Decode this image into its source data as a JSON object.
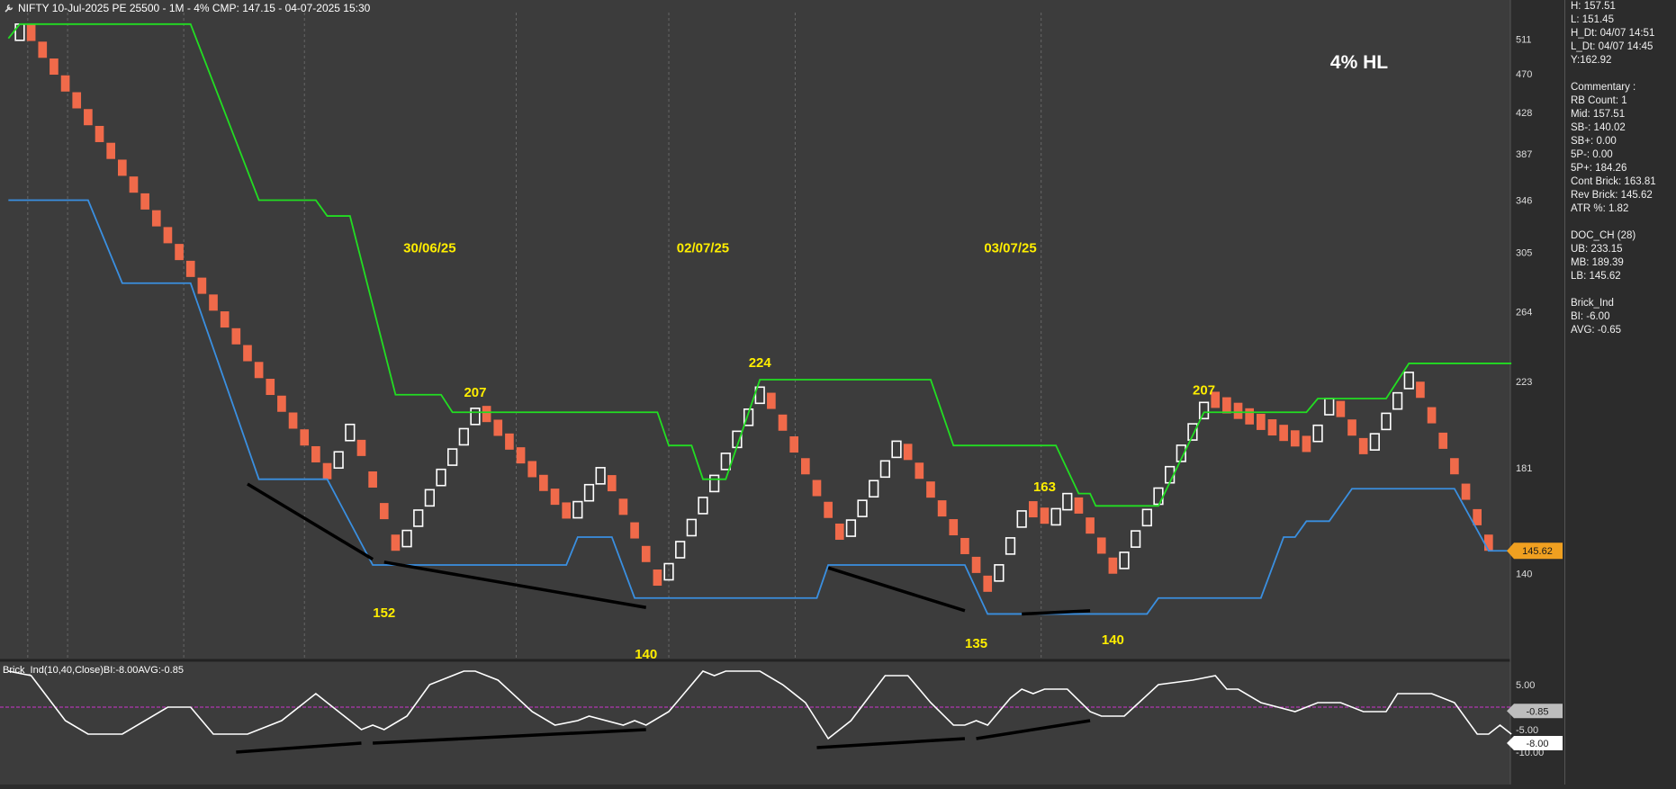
{
  "header": {
    "title": "NIFTY 10-Jul-2025 PE 25500 - 1M - 4% CMP: 147.15 - 04-07-2025 15:30",
    "corner_label": "4% HL"
  },
  "side_panel": {
    "groups": [
      [
        "H: 157.51",
        "L: 151.45",
        "H_Dt: 04/07 14:51",
        "L_Dt: 04/07 14:45",
        "Y:162.92"
      ],
      [
        "Commentary :",
        "RB Count: 1",
        "Mid: 157.51",
        "SB-: 140.02",
        "SB+: 0.00",
        "5P-: 0.00",
        "5P+: 184.26",
        "Cont Brick: 163.81",
        "Rev Brick: 145.62",
        "ATR %: 1.82"
      ],
      [
        "DOC_CH (28)",
        "UB: 233.15",
        "MB: 189.39",
        "LB: 145.62"
      ],
      [
        "Brick_Ind",
        "BI: -6.00",
        "AVG: -0.65"
      ]
    ]
  },
  "colors": {
    "background": "#3c3c3c",
    "up_brick": "#ffffff",
    "down_brick": "#f06a4a",
    "upper_band": "#22dd22",
    "lower_band": "#3a8fe0",
    "annotation": "#ffee00",
    "indicator_line": "#ffffff",
    "zero_line": "#cc33cc",
    "price_tag": "#f0a020"
  },
  "chart_data": [
    {
      "type": "renko",
      "title": "NIFTY 10-Jul-2025 PE 25500 - 1M - 4% CMP: 147.15 - 04-07-2025 15:30",
      "ylim": [
        114,
        545
      ],
      "y_ticks": [
        140,
        181,
        223,
        264,
        305,
        346,
        387,
        428,
        470,
        511
      ],
      "brick_size_pct": 4,
      "n_columns": 133,
      "date_labels": [
        {
          "text": "30/06/25",
          "col": 37,
          "y": 305
        },
        {
          "text": "02/07/25",
          "col": 61,
          "y": 305
        },
        {
          "text": "03/07/25",
          "col": 88,
          "y": 305
        }
      ],
      "price_annotations": [
        {
          "text": "152",
          "col": 33,
          "y": 126
        },
        {
          "text": "207",
          "col": 41,
          "y": 215
        },
        {
          "text": "140",
          "col": 56,
          "y": 114
        },
        {
          "text": "224",
          "col": 66,
          "y": 231
        },
        {
          "text": "135",
          "col": 85,
          "y": 117
        },
        {
          "text": "163",
          "col": 91,
          "y": 171
        },
        {
          "text": "140",
          "col": 97,
          "y": 118
        },
        {
          "text": "207",
          "col": 105,
          "y": 216
        }
      ],
      "current_price_tag": "145.62",
      "pivots": [
        {
          "col": 0,
          "y": 475
        },
        {
          "col": 1,
          "y": 530
        },
        {
          "col": 28,
          "y": 176
        },
        {
          "col": 30,
          "y": 201
        },
        {
          "col": 34,
          "y": 148
        },
        {
          "col": 41,
          "y": 209
        },
        {
          "col": 49,
          "y": 160
        },
        {
          "col": 52,
          "y": 181
        },
        {
          "col": 57,
          "y": 136
        },
        {
          "col": 66,
          "y": 220
        },
        {
          "col": 73,
          "y": 152
        },
        {
          "col": 78,
          "y": 193
        },
        {
          "col": 86,
          "y": 134
        },
        {
          "col": 89,
          "y": 163
        },
        {
          "col": 91,
          "y": 158
        },
        {
          "col": 93,
          "y": 170
        },
        {
          "col": 97,
          "y": 140
        },
        {
          "col": 105,
          "y": 212
        },
        {
          "col": 114,
          "y": 188
        },
        {
          "col": 116,
          "y": 214
        },
        {
          "col": 119,
          "y": 187
        },
        {
          "col": 123,
          "y": 228
        },
        {
          "col": 130,
          "y": 148
        }
      ],
      "series": [
        {
          "name": "UB",
          "points": [
            {
              "col": 0,
              "y": 512
            },
            {
              "col": 1,
              "y": 530
            },
            {
              "col": 16,
              "y": 530
            },
            {
              "col": 22,
              "y": 346
            },
            {
              "col": 27,
              "y": 346
            },
            {
              "col": 28,
              "y": 333
            },
            {
              "col": 30,
              "y": 333
            },
            {
              "col": 34,
              "y": 216
            },
            {
              "col": 38,
              "y": 216
            },
            {
              "col": 39,
              "y": 207
            },
            {
              "col": 57,
              "y": 207
            },
            {
              "col": 58,
              "y": 191
            },
            {
              "col": 60,
              "y": 191
            },
            {
              "col": 61,
              "y": 176
            },
            {
              "col": 63,
              "y": 176
            },
            {
              "col": 66,
              "y": 224
            },
            {
              "col": 81,
              "y": 224
            },
            {
              "col": 83,
              "y": 191
            },
            {
              "col": 92,
              "y": 191
            },
            {
              "col": 94,
              "y": 170
            },
            {
              "col": 95,
              "y": 170
            },
            {
              "col": 95.5,
              "y": 165
            },
            {
              "col": 101,
              "y": 165
            },
            {
              "col": 105,
              "y": 207
            },
            {
              "col": 114,
              "y": 207
            },
            {
              "col": 115,
              "y": 214
            },
            {
              "col": 121,
              "y": 214
            },
            {
              "col": 123,
              "y": 233
            },
            {
              "col": 132,
              "y": 233
            }
          ]
        },
        {
          "name": "LB",
          "points": [
            {
              "col": 0,
              "y": 346
            },
            {
              "col": 7,
              "y": 346
            },
            {
              "col": 10,
              "y": 283
            },
            {
              "col": 16,
              "y": 283
            },
            {
              "col": 22,
              "y": 176
            },
            {
              "col": 28,
              "y": 176
            },
            {
              "col": 32,
              "y": 143
            },
            {
              "col": 49,
              "y": 143
            },
            {
              "col": 50,
              "y": 153
            },
            {
              "col": 53,
              "y": 153
            },
            {
              "col": 55,
              "y": 132
            },
            {
              "col": 71,
              "y": 132
            },
            {
              "col": 72,
              "y": 143
            },
            {
              "col": 84,
              "y": 143
            },
            {
              "col": 86,
              "y": 127
            },
            {
              "col": 100,
              "y": 127
            },
            {
              "col": 101,
              "y": 132
            },
            {
              "col": 110,
              "y": 132
            },
            {
              "col": 112,
              "y": 153
            },
            {
              "col": 113,
              "y": 153
            },
            {
              "col": 114,
              "y": 159
            },
            {
              "col": 116,
              "y": 159
            },
            {
              "col": 118,
              "y": 172
            },
            {
              "col": 127,
              "y": 172
            },
            {
              "col": 130,
              "y": 148
            },
            {
              "col": 132,
              "y": 148
            }
          ]
        }
      ],
      "trendlines": [
        {
          "from": {
            "col": 21,
            "y": 174
          },
          "to": {
            "col": 32,
            "y": 145
          }
        },
        {
          "from": {
            "col": 33,
            "y": 144
          },
          "to": {
            "col": 56,
            "y": 129
          }
        },
        {
          "from": {
            "col": 72,
            "y": 142
          },
          "to": {
            "col": 84,
            "y": 128
          }
        },
        {
          "from": {
            "col": 89,
            "y": 127
          },
          "to": {
            "col": 95,
            "y": 128
          }
        }
      ]
    },
    {
      "type": "line",
      "title": "Brick_Ind(10,40,Close)BI:-8.00AVG:-0.85",
      "ylim": [
        -16,
        10
      ],
      "y_ticks": [
        5,
        0,
        -5,
        -10
      ],
      "y_tick_labels": [
        "5.00",
        "0.00",
        "-5.00",
        "-10.00"
      ],
      "zero_line": 0,
      "current_value_tags": [
        {
          "text": "-0.85",
          "value": -0.85,
          "style": "grey"
        },
        {
          "text": "-8.00",
          "value": -8.0,
          "style": "white"
        }
      ],
      "series": [
        {
          "name": "BI",
          "points": [
            {
              "col": 0,
              "y": 8
            },
            {
              "col": 2,
              "y": 7
            },
            {
              "col": 5,
              "y": -3
            },
            {
              "col": 7,
              "y": -6
            },
            {
              "col": 10,
              "y": -6
            },
            {
              "col": 14,
              "y": 0
            },
            {
              "col": 16,
              "y": 0
            },
            {
              "col": 18,
              "y": -6
            },
            {
              "col": 21,
              "y": -6
            },
            {
              "col": 24,
              "y": -3
            },
            {
              "col": 26,
              "y": 1
            },
            {
              "col": 27,
              "y": 3
            },
            {
              "col": 30,
              "y": -3
            },
            {
              "col": 31,
              "y": -5
            },
            {
              "col": 32,
              "y": -4
            },
            {
              "col": 33,
              "y": -5
            },
            {
              "col": 35,
              "y": -2
            },
            {
              "col": 37,
              "y": 5
            },
            {
              "col": 40,
              "y": 8
            },
            {
              "col": 41,
              "y": 8
            },
            {
              "col": 43,
              "y": 6
            },
            {
              "col": 46,
              "y": -1
            },
            {
              "col": 48,
              "y": -4
            },
            {
              "col": 50,
              "y": -3
            },
            {
              "col": 51,
              "y": -2
            },
            {
              "col": 54,
              "y": -4
            },
            {
              "col": 55,
              "y": -3
            },
            {
              "col": 56,
              "y": -4
            },
            {
              "col": 58,
              "y": -1
            },
            {
              "col": 61,
              "y": 8
            },
            {
              "col": 62,
              "y": 7
            },
            {
              "col": 63,
              "y": 8
            },
            {
              "col": 66,
              "y": 8
            },
            {
              "col": 68,
              "y": 5
            },
            {
              "col": 70,
              "y": 1
            },
            {
              "col": 72,
              "y": -7
            },
            {
              "col": 74,
              "y": -3
            },
            {
              "col": 77,
              "y": 7
            },
            {
              "col": 79,
              "y": 7
            },
            {
              "col": 81,
              "y": 1
            },
            {
              "col": 83,
              "y": -4
            },
            {
              "col": 84,
              "y": -4
            },
            {
              "col": 85,
              "y": -3
            },
            {
              "col": 86,
              "y": -4
            },
            {
              "col": 88,
              "y": 2
            },
            {
              "col": 89,
              "y": 4
            },
            {
              "col": 90,
              "y": 3
            },
            {
              "col": 91,
              "y": 4
            },
            {
              "col": 93,
              "y": 4
            },
            {
              "col": 95,
              "y": -1
            },
            {
              "col": 96,
              "y": -2
            },
            {
              "col": 98,
              "y": -2
            },
            {
              "col": 101,
              "y": 5
            },
            {
              "col": 104,
              "y": 6
            },
            {
              "col": 106,
              "y": 7
            },
            {
              "col": 107,
              "y": 4
            },
            {
              "col": 108,
              "y": 4
            },
            {
              "col": 110,
              "y": 1
            },
            {
              "col": 113,
              "y": -1
            },
            {
              "col": 115,
              "y": 1
            },
            {
              "col": 117,
              "y": 1
            },
            {
              "col": 119,
              "y": -1
            },
            {
              "col": 121,
              "y": -1
            },
            {
              "col": 122,
              "y": 3
            },
            {
              "col": 125,
              "y": 3
            },
            {
              "col": 127,
              "y": 1
            },
            {
              "col": 129,
              "y": -6
            },
            {
              "col": 130,
              "y": -6
            },
            {
              "col": 131,
              "y": -4
            },
            {
              "col": 132,
              "y": -6
            }
          ]
        }
      ],
      "trendlines": [
        {
          "from": {
            "col": 20,
            "y": -10
          },
          "to": {
            "col": 31,
            "y": -8
          }
        },
        {
          "from": {
            "col": 32,
            "y": -8
          },
          "to": {
            "col": 56,
            "y": -5
          }
        },
        {
          "from": {
            "col": 71,
            "y": -9
          },
          "to": {
            "col": 84,
            "y": -7
          }
        },
        {
          "from": {
            "col": 85,
            "y": -7
          },
          "to": {
            "col": 95,
            "y": -3
          }
        }
      ]
    }
  ]
}
